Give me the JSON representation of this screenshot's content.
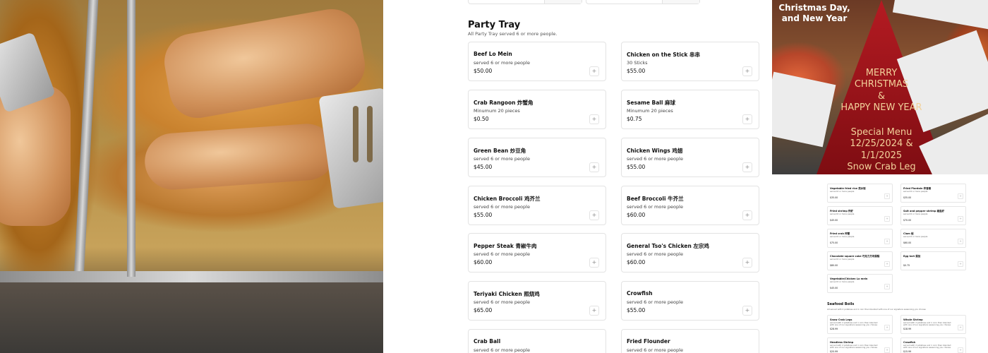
{
  "section": {
    "title": "Party Tray",
    "subtitle": "All Party Tray served 6 or more people."
  },
  "items": [
    {
      "name": "Beef Lo Mein",
      "desc": "served 6 or more people",
      "price": "$50.00",
      "add": "+"
    },
    {
      "name": "Chicken on the Stick 串串",
      "desc": "30 Sticks",
      "price": "$55.00",
      "add": "+"
    },
    {
      "name": "Crab Rangoon 炸蟹角",
      "desc": "Minumum 20 pieces",
      "price": "$0.50",
      "add": "+"
    },
    {
      "name": "Sesame Ball 麻球",
      "desc": "Minumum 20 pieces",
      "price": "$0.75",
      "add": "+"
    },
    {
      "name": "Green Bean 炒豆角",
      "desc": "served 6 or more people",
      "price": "$45.00",
      "add": "+"
    },
    {
      "name": "Chicken Wings 鸡翅",
      "desc": "served 6 or more people",
      "price": "$55.00",
      "add": "+"
    },
    {
      "name": "Chicken Broccoli 鸡芥兰",
      "desc": "served 6 or more people",
      "price": "$55.00",
      "add": "+"
    },
    {
      "name": "Beef Broccoli 牛芥兰",
      "desc": "served 6 or more people",
      "price": "$60.00",
      "add": "+"
    },
    {
      "name": "Pepper Steak 青椒牛肉",
      "desc": "served 6 or more people",
      "price": "$60.00",
      "add": "+"
    },
    {
      "name": "General Tso's Chicken 左宗鸡",
      "desc": "served 6 or more people",
      "price": "$60.00",
      "add": "+"
    },
    {
      "name": "Teriyaki Chicken 照烧鸡",
      "desc": "served 6 or more people",
      "price": "$65.00",
      "add": "+"
    },
    {
      "name": "Crowfish",
      "desc": "served 6 or more people",
      "price": "$55.00",
      "add": "+"
    },
    {
      "name": "Crab Ball",
      "desc": "served 6 or more people",
      "price": "",
      "add": "+"
    },
    {
      "name": "Fried Flounder",
      "desc": "served 6 or more people",
      "price": "",
      "add": "+"
    }
  ],
  "poster": {
    "top_lines": [
      "Christmas Day,",
      "and New Year"
    ],
    "greeting": [
      "MERRY",
      "CHRISTMAS",
      "&",
      "HAPPY NEW YEAR"
    ],
    "special": [
      "Special Menu",
      "12/25/2024 &",
      "1/1/2025",
      "Snow Crab Leg"
    ]
  },
  "mini": {
    "items": [
      {
        "name": "Vegetable fried rice 菜炒饭",
        "desc": "served 6 or more people",
        "price": "$35.00"
      },
      {
        "name": "Fried Plantain 炸香蕉",
        "desc": "served 6 or more people",
        "price": "$35.00"
      },
      {
        "name": "Fried shrimp 炸虾",
        "desc": "served 6 or more people",
        "price": "$45.00"
      },
      {
        "name": "Salt and pepper shrimp 椒盐虾",
        "desc": "served 6 or more people",
        "price": "$70.00"
      },
      {
        "name": "Fried crab 炸蟹",
        "desc": "served 6 or more people",
        "price": "$75.00"
      },
      {
        "name": "Clam 蚬",
        "desc": "served 6 or more people",
        "price": "$60.00"
      },
      {
        "name": "Chocolate square cake 巧克力方块蛋糕",
        "desc": "served 6 or more people",
        "price": "$80.00"
      },
      {
        "name": "Egg tart 蛋挞",
        "desc": "",
        "price": "$0.75"
      },
      {
        "name": "Vegetable/Chicken Lo mein",
        "desc": "served 6 or more people",
        "price": "$45.00"
      },
      {
        "name": "Snow Crab Legs",
        "desc": "served with 2 potatoes and 1 corn then blended with one of our signature seasoning you choose",
        "price": "$28.99"
      },
      {
        "name": "Whole Shrimp",
        "desc": "served with 2 potatoes and 1 corn then blended with one of our signature seasoning you choose",
        "price": "$18.99"
      },
      {
        "name": "Headless Shrimp",
        "desc": "served with 2 potatoes and 1 corn then blended with one of our signature seasoning you choose",
        "price": "$20.99"
      },
      {
        "name": "Crawfish",
        "desc": "served with 2 potatoes and 1 corn then blended with one of our signature seasoning you choose",
        "price": "$15.99"
      }
    ],
    "section_title": "Seafood Boils",
    "section_sub": "All served with 2 potatoes and 1 corn then blended with one of our signature seasoning you choose"
  }
}
